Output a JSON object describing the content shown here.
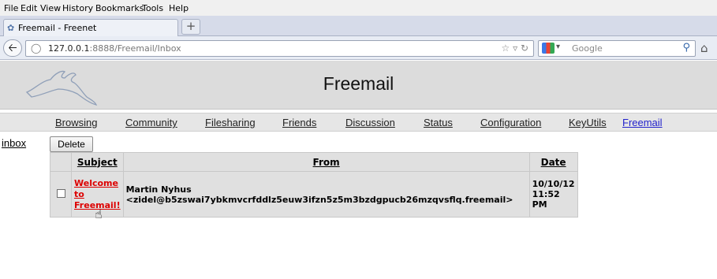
{
  "menu": [
    "File",
    "Edit",
    "View",
    "History",
    "Bookmarks",
    "Tools",
    "Help"
  ],
  "tab": {
    "title": "Freemail - Freenet",
    "new_tab": "+"
  },
  "url": {
    "host": "127.0.0.1",
    "path": ":8888/Freemail/Inbox"
  },
  "search": {
    "placeholder": "Google"
  },
  "page": {
    "title": "Freemail"
  },
  "nav": [
    "Browsing",
    "Community",
    "Filesharing",
    "Friends",
    "Discussion",
    "Status",
    "Configuration",
    "KeyUtils",
    "Freemail"
  ],
  "folder": "inbox",
  "delete_label": "Delete",
  "table": {
    "headers": {
      "subject": "Subject",
      "from": "From",
      "date": "Date"
    },
    "rows": [
      {
        "subject_lines": [
          "Welcome",
          "to",
          "Freemail!"
        ],
        "from_name": "Martin Nyhus",
        "from_address": "<zidel@b5zswai7ybkmvcrfddlz5euw3ifzn5z5m3bzdgpucb26mzqvsflq.freemail>",
        "date_lines": [
          "10/10/12",
          "11:52",
          "PM"
        ]
      }
    ]
  }
}
